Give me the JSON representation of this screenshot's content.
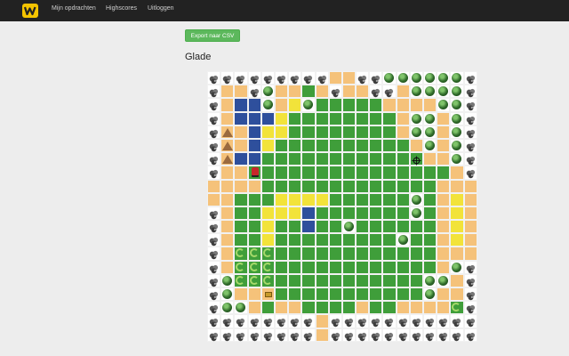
{
  "app": {
    "logo_icon": "w-logo-icon",
    "colors": {
      "navbar": "#222222",
      "accent": "#5cb85c"
    }
  },
  "nav": {
    "items": [
      {
        "label": "Mijn opdrachten"
      },
      {
        "label": "Highscores"
      },
      {
        "label": "Uitloggen"
      }
    ]
  },
  "toolbar": {
    "export_label": "Export naar CSV"
  },
  "page": {
    "title": "Glade"
  },
  "map": {
    "legend": {
      "R": "rock",
      "T": "tree",
      "G": "grass",
      "S": "sand",
      "Y": "yellow-sand",
      "W": "water",
      "K": "tent",
      "V": "vine",
      "H": "hero",
      "X": "target",
      "C": "chest"
    },
    "rows": [
      "RRRRRRRRRSSRRTTTTTTR",
      "RSSRTSSGSRSSRRSTTTTR",
      "RSWWTSYTGGGGGSSSSTTR",
      "RSWWWYGGGGGGGGSTTSTR",
      "RKSWYYGGGGGGGGSTTSTR",
      "RKSWYGGGGGGGGGGSTSTR",
      "RKWWGGGGGGGGGGGXSSTR",
      "RSSHGGGGGGGGGGGGGGSR",
      "SSSSGGGGGGGGGGGGGSSS",
      "SSGGGYYYYGGGGGGTGSYS",
      "RSGGYYYWGGGGGGGTGSYS",
      "RSGGYGGWGGTGGGGGGSYS",
      "RSGGYGGGGGGGGGTGGSYS",
      "RSVVVGGGGGGGGGGGGSSS",
      "RSVVVGGGGGGGGGGGGSTR",
      "RTVVVGGGGGGGGGGGTTSR",
      "RTSSCGGGGGGGGGGGTSSR",
      "RTTSGSSGGGGSGGSSSSVR",
      "RRRRRRRRSRRRRRRRRRRR",
      "RRRRRRRRSRRRRRRRRRRR"
    ]
  }
}
